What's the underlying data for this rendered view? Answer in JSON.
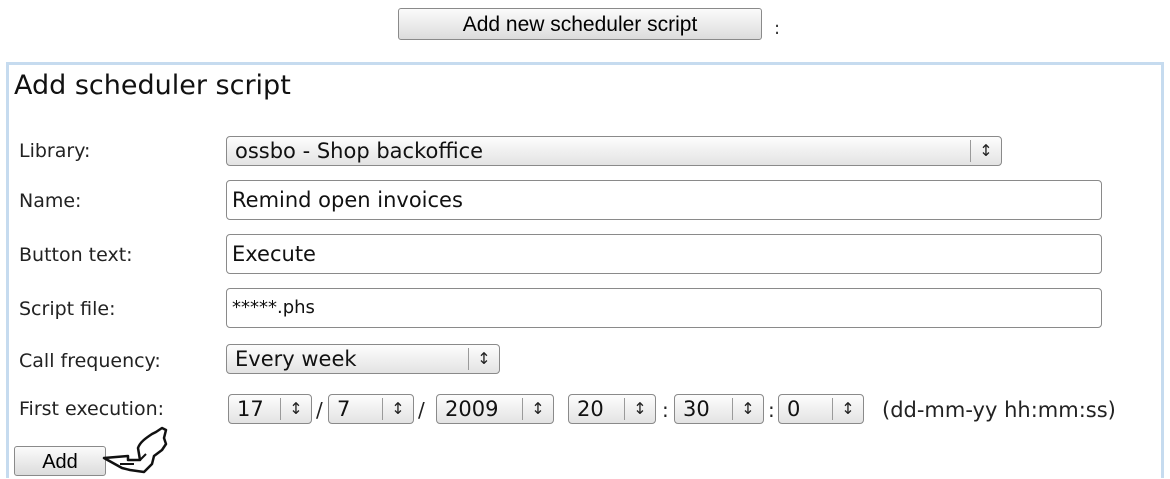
{
  "top_button": {
    "label": "Add new scheduler script",
    "suffix": ":"
  },
  "form": {
    "title": "Add scheduler script",
    "library": {
      "label": "Library:",
      "value": "ossbo - Shop backoffice"
    },
    "name": {
      "label": "Name:",
      "value": "Remind open invoices"
    },
    "button_text": {
      "label": "Button text:",
      "value": "Execute"
    },
    "script_file": {
      "label": "Script file:",
      "value": "*****.phs"
    },
    "call_frequency": {
      "label": "Call frequency:",
      "value": "Every week"
    },
    "first_execution": {
      "label": "First execution:",
      "day": "17",
      "month": "7",
      "year": "2009",
      "hour": "20",
      "minute": "30",
      "second": "0",
      "date_sep": "/",
      "time_sep": ":",
      "format_hint": "(dd-mm-yy hh:mm:ss)"
    },
    "submit_label": "Add"
  },
  "icons": {
    "select_arrows": "up-down-arrows-icon",
    "cursor": "hand-pointer-icon"
  },
  "colors": {
    "panel_border": "#c6dbef",
    "button_bg": "#e6e6e6"
  }
}
